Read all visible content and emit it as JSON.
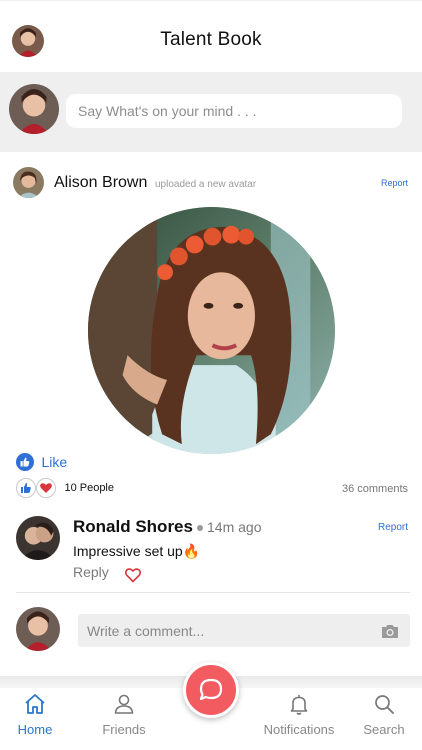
{
  "header": {
    "title": "Talent Book"
  },
  "composer": {
    "placeholder": "Say What's on your mind . . ."
  },
  "post": {
    "author": "Alison Brown",
    "action": "uploaded a new avatar",
    "report": "Report",
    "like_label": "Like",
    "likes_count": "10 People",
    "comments_count": "36 comments"
  },
  "comment": {
    "author": "Ronald Shores",
    "time": "14m ago",
    "report": "Report",
    "text": "Impressive set up",
    "emoji": "🔥",
    "reply_label": "Reply"
  },
  "comment_input": {
    "placeholder": "Write a comment..."
  },
  "nav": {
    "home": "Home",
    "friends": "Friends",
    "notifications": "Notifications",
    "search": "Search"
  },
  "colors": {
    "accent": "#2b76c9",
    "fab": "#f25c61",
    "report_link": "#2d6fd8",
    "heart": "#d9363e"
  },
  "icons": [
    "thumbs-up-icon",
    "heart-icon",
    "camera-icon",
    "home-icon",
    "user-icon",
    "bell-icon",
    "search-icon",
    "chat-bubble-icon"
  ]
}
